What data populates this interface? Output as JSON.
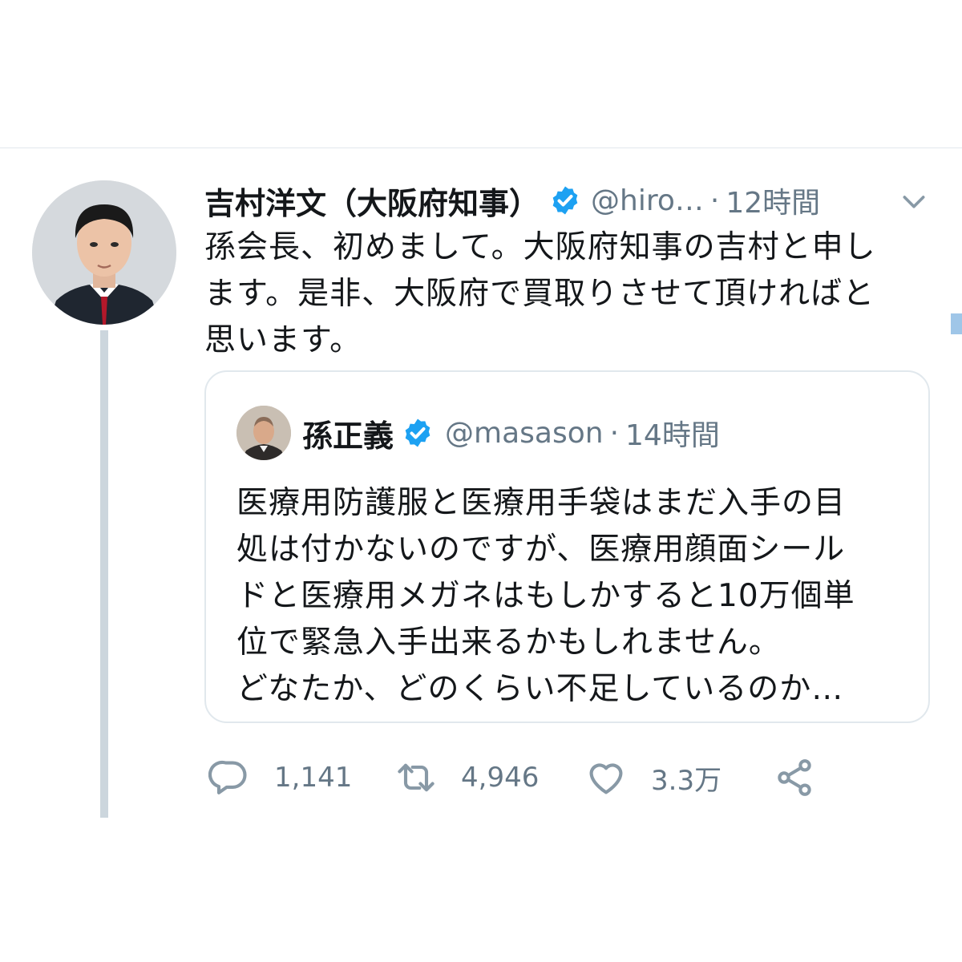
{
  "tweet": {
    "author_name": "吉村洋文（大阪府知事）",
    "handle": "@hiro…",
    "separator": "·",
    "time": "12時間",
    "text": "孫会長、初めまして。大阪府知事の吉村と申し\nます。是非、大阪府で買取りさせて頂ければと\n思います。"
  },
  "quote": {
    "author_name": "孫正義",
    "handle": "@masason",
    "separator": "·",
    "time": "14時間",
    "text": "医療用防護服と医療用手袋はまだ入手の目\n処は付かないのですが、医療用顔面シール\nドと医療用メガネはもしかすると10万個単\n位で緊急入手出来るかもしれません。\nどなたか、どのくらい不足しているのか…"
  },
  "actions": {
    "reply": {
      "icon": "reply-icon",
      "count": "1,141"
    },
    "retweet": {
      "icon": "retweet-icon",
      "count": "4,946"
    },
    "like": {
      "icon": "heart-icon",
      "count": "3.3万"
    },
    "share": {
      "icon": "share-icon"
    }
  },
  "colors": {
    "verified": "#1da1f2",
    "muted_text": "#657786",
    "border": "#e1e8ed",
    "thread_line": "#ccd6dd"
  }
}
